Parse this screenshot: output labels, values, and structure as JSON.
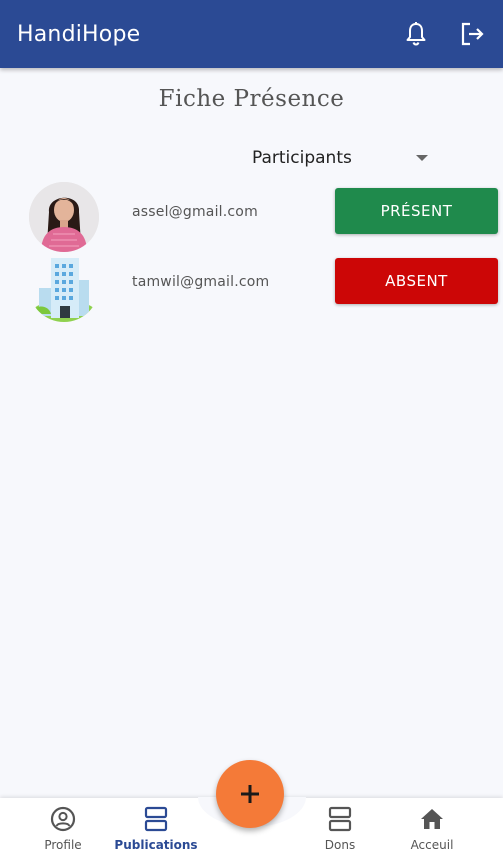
{
  "appbar": {
    "title": "HandiHope",
    "icons": [
      "bell-icon",
      "logout-icon"
    ]
  },
  "page": {
    "title": "Fiche Présence"
  },
  "dropdown": {
    "selected": "Participants"
  },
  "participants": [
    {
      "email": "assel@gmail.com",
      "status": "PRÉSENT",
      "status_color": "#1f8a4c",
      "avatar": "woman-photo"
    },
    {
      "email": "tamwil@gmail.com",
      "status": "ABSENT",
      "status_color": "#cc0606",
      "avatar": "building-icon"
    }
  ],
  "bottom_nav": {
    "items": [
      {
        "label": "Profile",
        "icon": "profile-icon",
        "active": false
      },
      {
        "label": "Publications",
        "icon": "publications-icon",
        "active": true
      },
      {
        "label": "Dons",
        "icon": "dons-icon",
        "active": false
      },
      {
        "label": "Acceuil",
        "icon": "home-icon",
        "active": false
      }
    ]
  },
  "fab": {
    "label": "+",
    "color": "#f47a38"
  },
  "colors": {
    "primary": "#2b4a94",
    "background": "#f7f8fc"
  }
}
